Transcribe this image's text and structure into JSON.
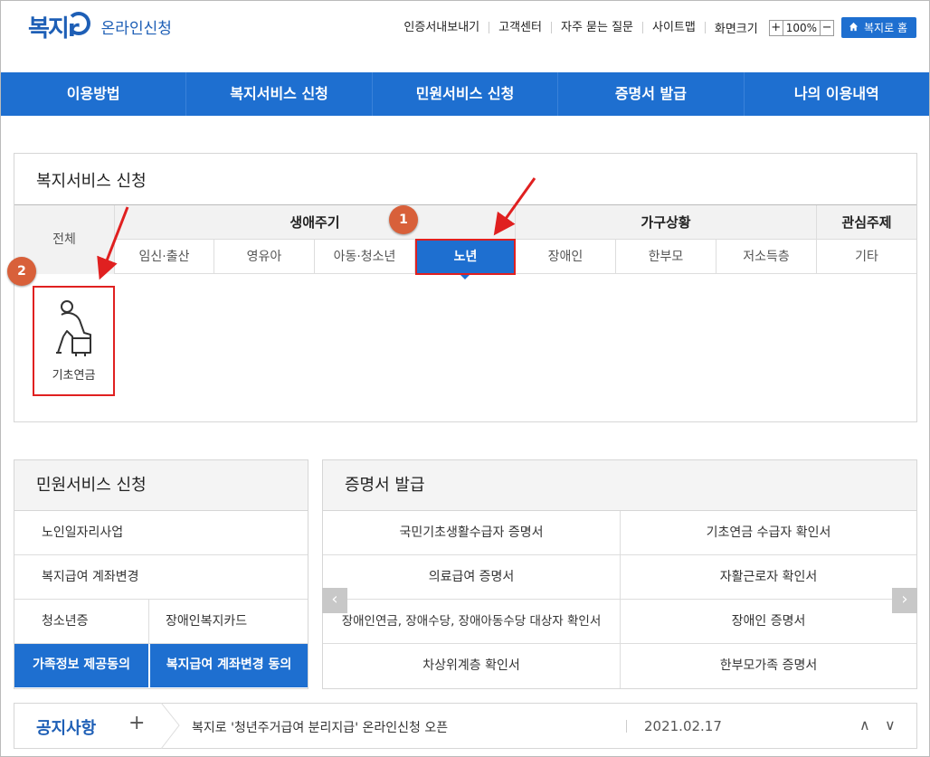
{
  "header": {
    "logo_mark": "복지r",
    "logo_text": "온라인신청",
    "util_links": [
      "인증서내보내기",
      "고객센터",
      "자주 묻는 질문",
      "사이트맵"
    ],
    "zoom_label": "화면크기",
    "zoom_plus": "+",
    "zoom_value": "100%",
    "zoom_minus": "−",
    "home_button": "복지로 홈"
  },
  "nav": [
    "이용방법",
    "복지서비스 신청",
    "민원서비스 신청",
    "증명서 발급",
    "나의 이용내역"
  ],
  "welfare": {
    "title": "복지서비스 신청",
    "all_label": "전체",
    "group_lifecycle": "생애주기",
    "group_household": "가구상황",
    "group_interest": "관심주제",
    "tabs": [
      "임신·출산",
      "영유아",
      "아동·청소년",
      "노년",
      "장애인",
      "한부모",
      "저소득층",
      "기타"
    ],
    "selected_tab": "노년",
    "service_card_label": "기초연금",
    "badge1": "1",
    "badge2": "2"
  },
  "civil": {
    "title": "민원서비스 신청",
    "rows": [
      "노인일자리사업",
      "복지급여 계좌변경"
    ],
    "split_row": [
      "청소년증",
      "장애인복지카드"
    ],
    "buttons": [
      "가족정보 제공동의",
      "복지급여 계좌변경 동의"
    ]
  },
  "cert": {
    "title": "증명서 발급",
    "items": [
      [
        "국민기초생활수급자 증명서",
        "기초연금 수급자 확인서"
      ],
      [
        "의료급여 증명서",
        "자활근로자 확인서"
      ],
      [
        "장애인연금, 장애수당, 장애아동수당 대상자 확인서",
        "장애인 증명서"
      ],
      [
        "차상위계층 확인서",
        "한부모가족 증명서"
      ]
    ],
    "prev": "‹",
    "next": "›"
  },
  "notice": {
    "title": "공지사항",
    "plus": "+",
    "text": "복지로 '청년주거급여 분리지급' 온라인신청 오픈",
    "date": "2021.02.17",
    "up": "∧",
    "down": "∨"
  },
  "colors": {
    "brand": "#1e6fd0",
    "highlight": "#e02020",
    "badge": "#d8603a"
  }
}
